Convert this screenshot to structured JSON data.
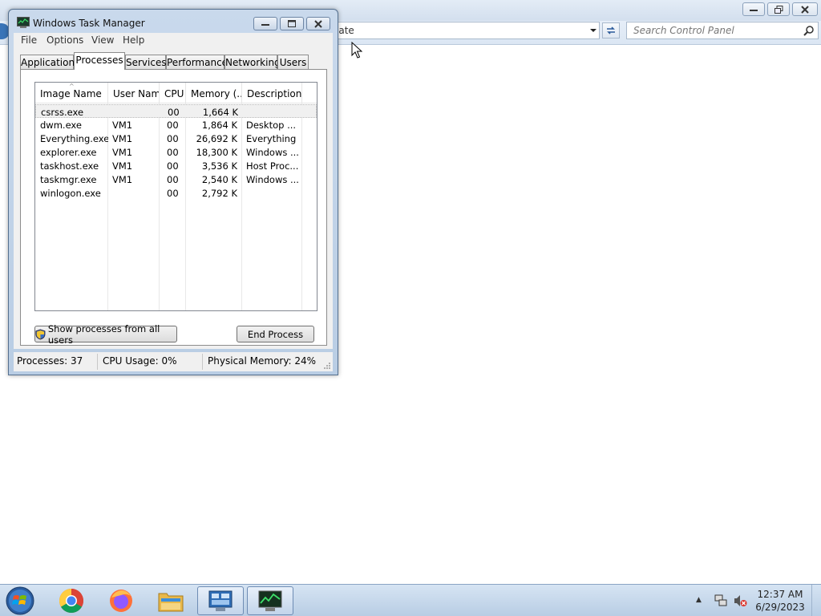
{
  "control_panel": {
    "address_text": "late",
    "search_placeholder": "Search Control Panel"
  },
  "task_manager": {
    "title": "Windows Task Manager",
    "menu": [
      "File",
      "Options",
      "View",
      "Help"
    ],
    "tabs": [
      "Applications",
      "Processes",
      "Services",
      "Performance",
      "Networking",
      "Users"
    ],
    "active_tab": "Processes",
    "columns": [
      "Image Name",
      "User Name",
      "CPU",
      "Memory (...",
      "Description"
    ],
    "processes": [
      {
        "name": "csrss.exe",
        "user": "",
        "cpu": "00",
        "memory": "1,664 K",
        "description": ""
      },
      {
        "name": "dwm.exe",
        "user": "VM1",
        "cpu": "00",
        "memory": "1,864 K",
        "description": "Desktop ..."
      },
      {
        "name": "Everything.exe",
        "user": "VM1",
        "cpu": "00",
        "memory": "26,692 K",
        "description": "Everything"
      },
      {
        "name": "explorer.exe",
        "user": "VM1",
        "cpu": "00",
        "memory": "18,300 K",
        "description": "Windows ..."
      },
      {
        "name": "taskhost.exe",
        "user": "VM1",
        "cpu": "00",
        "memory": "3,536 K",
        "description": "Host Proc..."
      },
      {
        "name": "taskmgr.exe",
        "user": "VM1",
        "cpu": "00",
        "memory": "2,540 K",
        "description": "Windows ..."
      },
      {
        "name": "winlogon.exe",
        "user": "",
        "cpu": "00",
        "memory": "2,792 K",
        "description": ""
      }
    ],
    "buttons": {
      "show_all": "Show processes from all users",
      "end_process": "End Process"
    },
    "status": {
      "processes": "Processes: 37",
      "cpu": "CPU Usage: 0%",
      "memory": "Physical Memory: 24%"
    }
  },
  "taskbar": {
    "pinned": [
      "chrome-icon",
      "firefox-icon",
      "file-explorer-icon",
      "control-panel-icon",
      "task-manager-icon"
    ],
    "clock_time": "12:37 AM",
    "clock_date": "6/29/2023"
  }
}
